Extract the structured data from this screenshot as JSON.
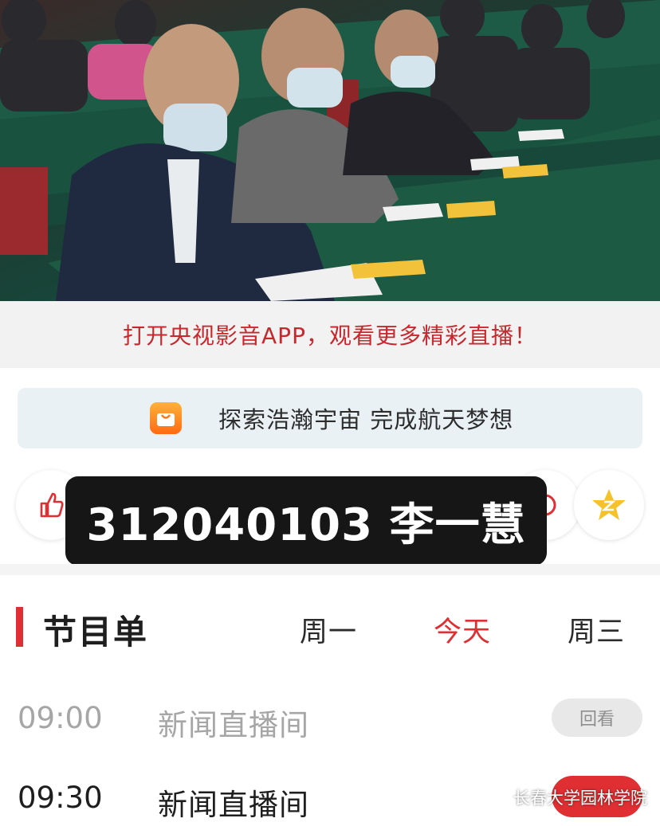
{
  "banner": {
    "open_app": "打开央视影音APP，观看更多精彩直播！"
  },
  "explore": {
    "text": "探索浩瀚宇宙 完成航天梦想",
    "icon": "shopping-bag-icon"
  },
  "actions": {
    "like_icon": "thumb-up-icon",
    "share_icon": "share-icon",
    "fav_icon": "star-icon"
  },
  "watermark": {
    "label": "312040103 李一慧"
  },
  "schedule": {
    "title": "节目单",
    "tabs": [
      {
        "label": "周一",
        "active": false
      },
      {
        "label": "今天",
        "active": true
      },
      {
        "label": "周三",
        "active": false
      }
    ],
    "programs": [
      {
        "time": "09:00",
        "name": "新闻直播间",
        "action": "回看"
      },
      {
        "time": "09:30",
        "name": "新闻直播间",
        "action": ""
      }
    ]
  },
  "source_watermark": {
    "text": "长春大学园林学院"
  },
  "colors": {
    "accent": "#e02f33",
    "banner_text": "#c8282d"
  }
}
